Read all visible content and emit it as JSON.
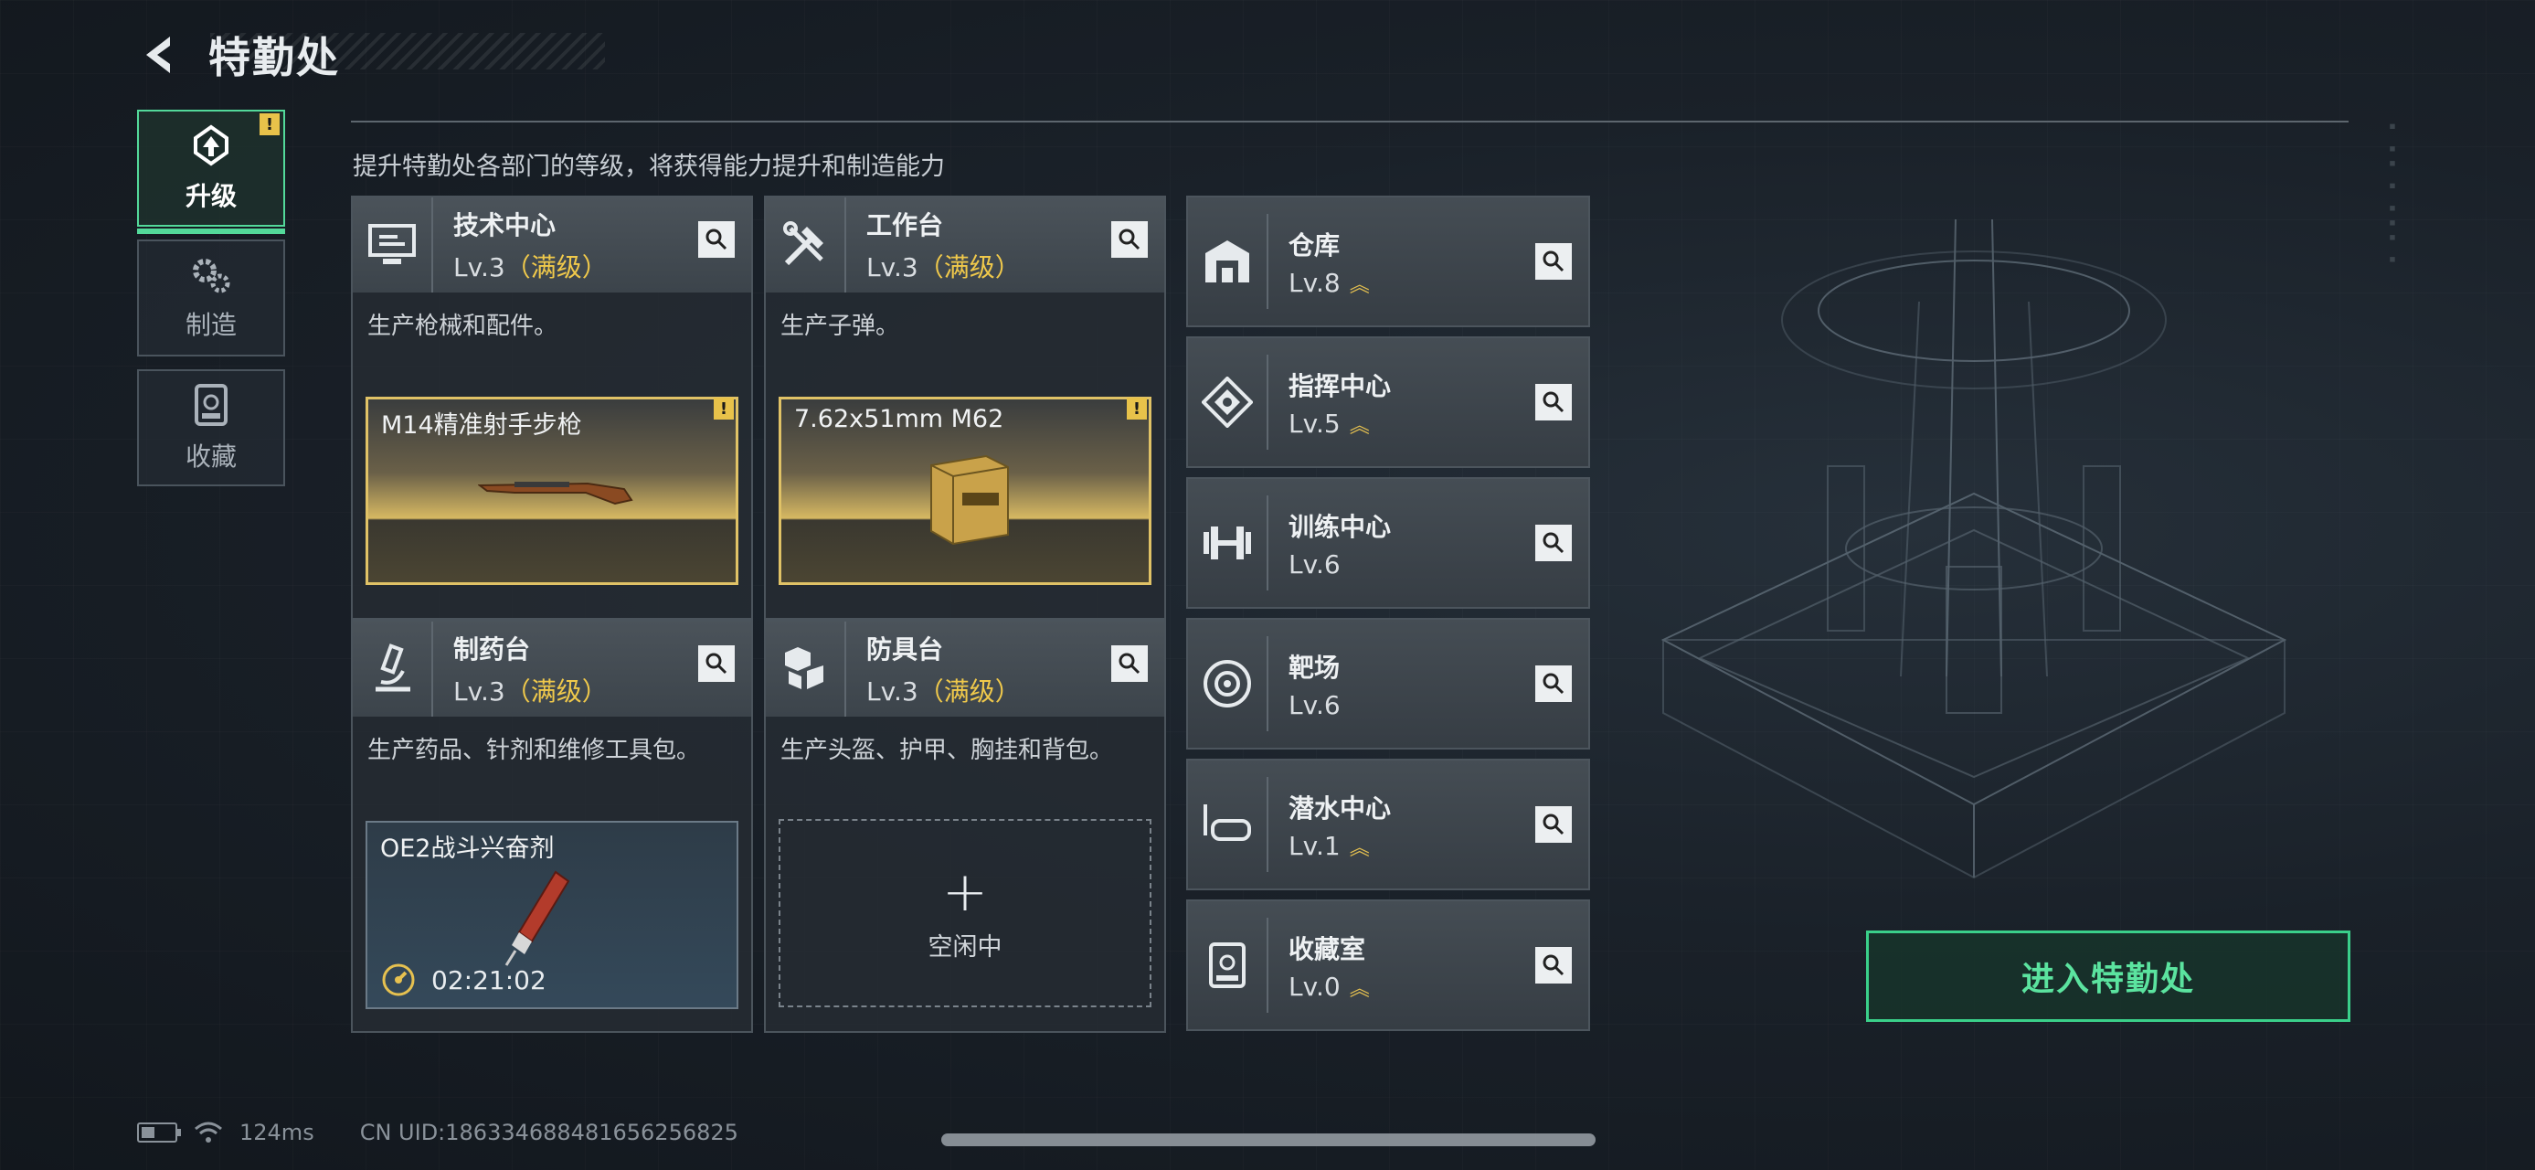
{
  "header": {
    "title": "特勤处",
    "back_icon": "back-chevron-icon"
  },
  "side_nav": [
    {
      "label": "升级",
      "icon": "upgrade-icon",
      "active": true,
      "badge": "!"
    },
    {
      "label": "制造",
      "icon": "gears-icon",
      "active": false
    },
    {
      "label": "收藏",
      "icon": "collection-icon",
      "active": false
    }
  ],
  "subtitle": "提升特勤处各部门的等级，将获得能力提升和制造能力",
  "cards": [
    {
      "name": "技术中心",
      "level": "Lv.3",
      "maxed": "（满级）",
      "icon": "computer-icon",
      "desc": "生产枪械和配件。",
      "product": {
        "name": "M14精准射手步枪",
        "badge": "!"
      }
    },
    {
      "name": "工作台",
      "level": "Lv.3",
      "maxed": "（满级）",
      "icon": "tools-icon",
      "desc": "生产子弹。",
      "product": {
        "name": "7.62x51mm M62",
        "badge": "!"
      }
    },
    {
      "name": "制药台",
      "level": "Lv.3",
      "maxed": "（满级）",
      "icon": "microscope-icon",
      "desc": "生产药品、针剂和维修工具包。",
      "product": {
        "name": "OE2战斗兴奋剂",
        "timer": "02:21:02"
      }
    },
    {
      "name": "防具台",
      "level": "Lv.3",
      "maxed": "（满级）",
      "icon": "armor-boxes-icon",
      "desc": "生产头盔、护甲、胸挂和背包。",
      "idle": {
        "plus": "+",
        "label": "空闲中"
      }
    }
  ],
  "list": [
    {
      "name": "仓库",
      "level": "Lv.8",
      "upgradable": true,
      "icon": "warehouse-icon"
    },
    {
      "name": "指挥中心",
      "level": "Lv.5",
      "upgradable": true,
      "icon": "command-center-icon"
    },
    {
      "name": "训练中心",
      "level": "Lv.6",
      "upgradable": false,
      "icon": "dumbbell-icon"
    },
    {
      "name": "靶场",
      "level": "Lv.6",
      "upgradable": false,
      "icon": "target-icon"
    },
    {
      "name": "潜水中心",
      "level": "Lv.1",
      "upgradable": true,
      "icon": "diving-mask-icon"
    },
    {
      "name": "收藏室",
      "level": "Lv.0",
      "upgradable": true,
      "icon": "collection-room-icon"
    }
  ],
  "upgrade_chevrons": "︽",
  "enter_button": "进入特勤处",
  "footer": {
    "ping": "124ms",
    "uid": "CN UID:18633468848165625682​5"
  },
  "colors": {
    "accent": "#53d99a",
    "gold": "#f0c94b",
    "enter_text": "#5be39f"
  }
}
